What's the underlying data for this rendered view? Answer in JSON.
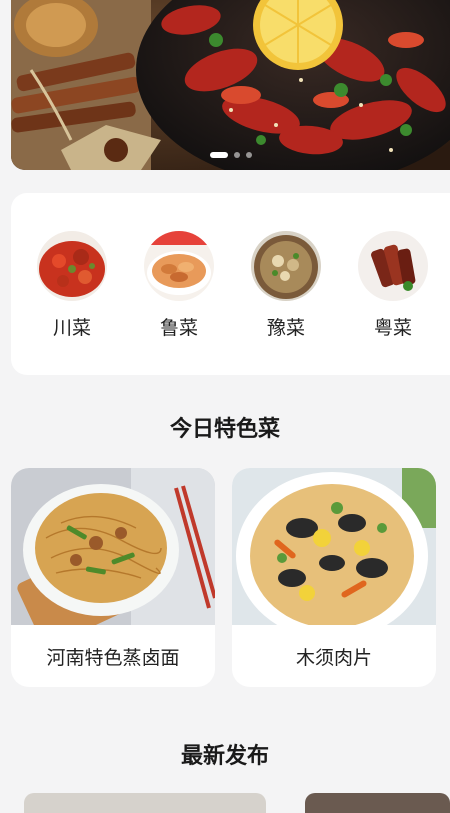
{
  "banner": {
    "image": "crayfish-dish-banner",
    "slides": 3,
    "active_slide": 0
  },
  "categories": [
    {
      "label": "川菜",
      "image": "sichuan-dish"
    },
    {
      "label": "鲁菜",
      "image": "shandong-dish"
    },
    {
      "label": "豫菜",
      "image": "henan-dish"
    },
    {
      "label": "粤菜",
      "image": "cantonese-dish"
    }
  ],
  "today_section": {
    "title": "今日特色菜",
    "dishes": [
      {
        "name": "河南特色蒸卤面",
        "image": "braised-noodles"
      },
      {
        "name": "木须肉片",
        "image": "muxu-pork"
      }
    ]
  },
  "latest_section": {
    "title": "最新发布"
  }
}
